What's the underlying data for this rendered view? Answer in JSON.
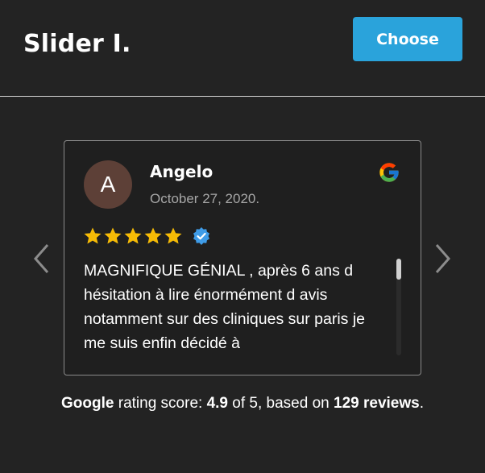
{
  "header": {
    "title": "Slider I.",
    "choose_label": "Choose"
  },
  "review": {
    "avatar_initial": "A",
    "author": "Angelo",
    "date": "October 27, 2020.",
    "rating": 5,
    "verified": true,
    "source_icon": "google-icon",
    "text": "MAGNIFIQUE GÉNIAL , après 6 ans d hésitation à lire énormément d avis notamment sur des cliniques sur paris je me suis enfin décidé à"
  },
  "summary": {
    "brand": "Google",
    "label_score": " rating score: ",
    "score": "4.9",
    "label_of": " of 5, based on ",
    "reviews": "129 reviews",
    "end": "."
  },
  "colors": {
    "background": "#232323",
    "accent": "#2aa3db",
    "star": "#f6bb06",
    "avatar": "#5d4037",
    "verified": "#3f9ce8"
  }
}
